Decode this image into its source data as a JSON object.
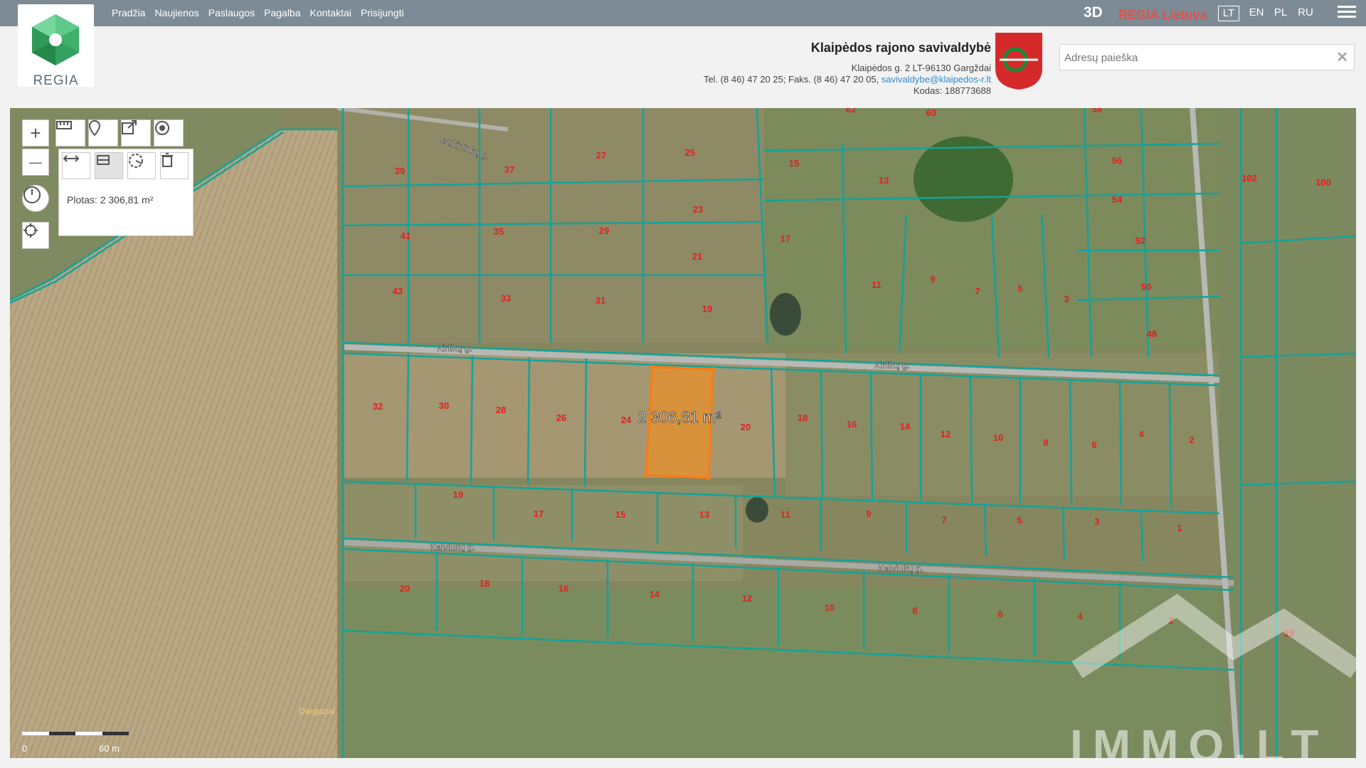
{
  "header": {
    "nav": [
      "Pradžia",
      "Naujienos",
      "Paslaugos",
      "Pagalba",
      "Kontaktai",
      "Prisijungti"
    ],
    "btn_3d": "3D",
    "regia_lietuva": "REGIA Lietuva",
    "languages": [
      "LT",
      "EN",
      "PL",
      "RU"
    ],
    "active_language": "LT",
    "logo_text": "REGIA"
  },
  "municipality": {
    "name": "Klaipėdos rajono savivaldybė",
    "address": "Klaipėdos g. 2 LT-96130 Gargždai",
    "tel": "Tel. (8 46) 47 20 25; Faks. (8 46) 47 20 05,",
    "email": "savivaldybe@klaipedos-r.lt",
    "code": "Kodas: 188773688"
  },
  "search": {
    "placeholder": "Adresų paieška",
    "value": ""
  },
  "tools": {
    "zoom_in": "+",
    "zoom_out": "—",
    "plotas_label": "Plotas: 2 306,81 m²"
  },
  "map": {
    "area_label": "2 306,81 m²",
    "scale_zero": "0",
    "scale_label": "60 m",
    "streets": [
      "Laukininkų g.",
      "Kirlikų g.",
      "Kirlikų g.",
      "Kalviukų g.",
      "Kalviukų g."
    ],
    "place": "Darguziai",
    "parcels_upper": [
      "39",
      "37",
      "27",
      "25",
      "15",
      "13",
      "56",
      "102",
      "100",
      "41",
      "35",
      "29",
      "23",
      "21",
      "17",
      "54",
      "52",
      "43",
      "33",
      "31",
      "19",
      "11",
      "9",
      "7",
      "5",
      "3",
      "50",
      "48",
      "62",
      "60",
      "58"
    ],
    "parcels_middle": [
      "32",
      "30",
      "28",
      "26",
      "24",
      "20",
      "18",
      "16",
      "14",
      "12",
      "10",
      "8",
      "6",
      "4",
      "2"
    ],
    "parcels_lower": [
      "19",
      "17",
      "15",
      "13",
      "11",
      "9",
      "7",
      "5",
      "3",
      "1"
    ],
    "parcels_bottom": [
      "20",
      "18",
      "16",
      "14",
      "12",
      "10",
      "8",
      "6",
      "4",
      "2",
      "19",
      "19"
    ],
    "watermark": "IMMO.LT"
  },
  "colors": {
    "topbar": "#7d8b96",
    "parcel_line": "#12a39a",
    "selection_fill": "#e8902a",
    "parcel_number": "#e02020",
    "regia_red": "#e0524a"
  }
}
